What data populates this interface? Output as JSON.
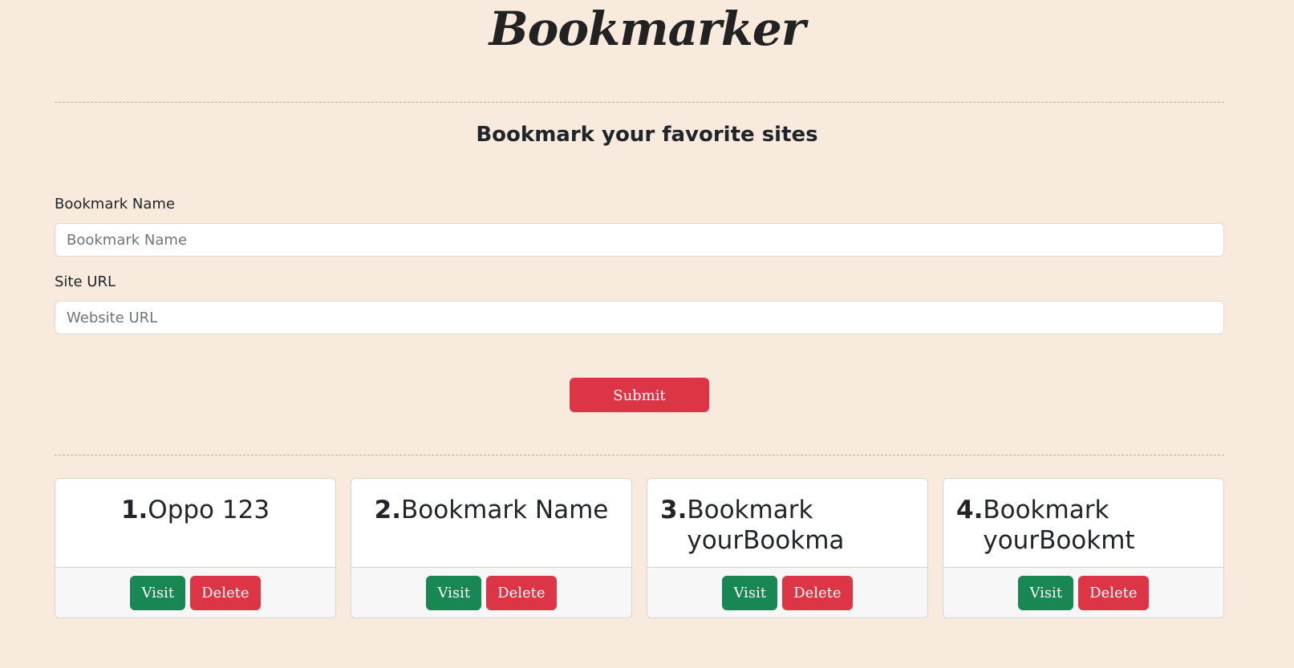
{
  "header": {
    "logo": "Bookmarker"
  },
  "form": {
    "subtitle": "Bookmark your favorite sites",
    "name_label": "Bookmark Name",
    "name_placeholder": "Bookmark Name",
    "name_value": "",
    "url_label": "Site URL",
    "url_placeholder": "Website URL",
    "url_value": "",
    "submit_label": "Submit"
  },
  "bookmarks": [
    {
      "number": "1.",
      "name": "Oppo 123",
      "visit_label": "Visit",
      "delete_label": "Delete"
    },
    {
      "number": "2.",
      "name": "Bookmark Name",
      "visit_label": "Visit",
      "delete_label": "Delete"
    },
    {
      "number": "3.",
      "name": "Bookmark yourBookma",
      "visit_label": "Visit",
      "delete_label": "Delete"
    },
    {
      "number": "4.",
      "name": "Bookmark yourBookmt",
      "visit_label": "Visit",
      "delete_label": "Delete"
    }
  ],
  "colors": {
    "background": "#f8ebde",
    "submit": "#dc3545",
    "visit": "#198754",
    "delete": "#dc3545"
  }
}
